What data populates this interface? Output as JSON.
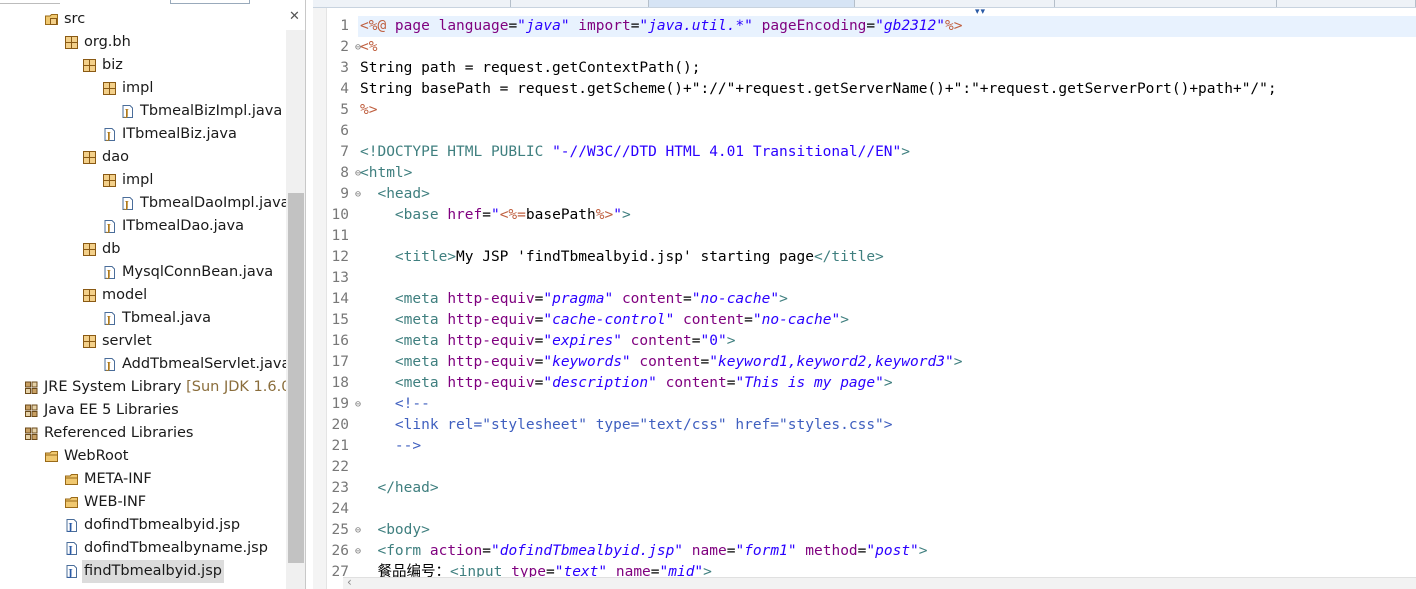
{
  "explorer": {
    "tree": [
      {
        "label": "src",
        "icon": "source-folder",
        "indent": 1
      },
      {
        "label": "org.bh",
        "icon": "package",
        "indent": 2
      },
      {
        "label": "biz",
        "icon": "package",
        "indent": 3
      },
      {
        "label": "impl",
        "icon": "package",
        "indent": 4
      },
      {
        "label": "TbmealBizImpl.java",
        "icon": "java-file",
        "indent": 5
      },
      {
        "label": "ITbmealBiz.java",
        "icon": "java-file",
        "indent": 4
      },
      {
        "label": "dao",
        "icon": "package",
        "indent": 3
      },
      {
        "label": "impl",
        "icon": "package",
        "indent": 4
      },
      {
        "label": "TbmealDaoImpl.java",
        "icon": "java-file",
        "indent": 5
      },
      {
        "label": "ITbmealDao.java",
        "icon": "java-file",
        "indent": 4
      },
      {
        "label": "db",
        "icon": "package",
        "indent": 3
      },
      {
        "label": "MysqlConnBean.java",
        "icon": "java-file",
        "indent": 4
      },
      {
        "label": "model",
        "icon": "package",
        "indent": 3
      },
      {
        "label": "Tbmeal.java",
        "icon": "java-file",
        "indent": 4
      },
      {
        "label": "servlet",
        "icon": "package",
        "indent": 3
      },
      {
        "label": "AddTbmealServlet.java",
        "icon": "java-file",
        "indent": 4
      },
      {
        "label": "JRE System Library",
        "qualifier": " [Sun JDK 1.6.0",
        "icon": "library",
        "indent": 0
      },
      {
        "label": "Java EE 5 Libraries",
        "icon": "library",
        "indent": 0
      },
      {
        "label": "Referenced Libraries",
        "icon": "library",
        "indent": 0
      },
      {
        "label": "WebRoot",
        "icon": "folder",
        "indent": 1
      },
      {
        "label": "META-INF",
        "icon": "folder",
        "indent": 2
      },
      {
        "label": "WEB-INF",
        "icon": "folder",
        "indent": 2
      },
      {
        "label": "dofindTbmealbyid.jsp",
        "icon": "jsp-file",
        "indent": 2
      },
      {
        "label": "dofindTbmealbyname.jsp",
        "icon": "jsp-file",
        "indent": 2
      },
      {
        "label": "findTbmealbyid.jsp",
        "icon": "jsp-file",
        "indent": 2,
        "selected": true
      }
    ]
  },
  "colors": {
    "keyword": "#7f0055",
    "tag": "#3f7f7f",
    "attr": "#7f007f",
    "string": "#2a00ff",
    "jsp_delim": "#bf5f3f",
    "doctype": "#3f7f7f",
    "comment": "#3f5fbf",
    "line_number": "#787878",
    "current_line": "#e8f2fe",
    "selection": "#dcdcdc"
  },
  "editor": {
    "lines": [
      {
        "n": "1",
        "current": true,
        "tokens": [
          [
            "jsp",
            "<%@"
          ],
          [
            "attr",
            " page "
          ],
          [
            "attr",
            "language"
          ],
          [
            "txt",
            "="
          ],
          [
            "str",
            "\"java\""
          ],
          [
            "txt",
            " "
          ],
          [
            "attr",
            "import"
          ],
          [
            "txt",
            "="
          ],
          [
            "str",
            "\"java.util.*\""
          ],
          [
            "txt",
            " "
          ],
          [
            "attr",
            "pageEncoding"
          ],
          [
            "txt",
            "="
          ],
          [
            "str",
            "\"gb2312\""
          ],
          [
            "jsp",
            "%>"
          ]
        ]
      },
      {
        "n": "2",
        "fold": "⊖",
        "tokens": [
          [
            "jsp",
            "<%"
          ]
        ]
      },
      {
        "n": "3",
        "tokens": [
          [
            "txt",
            "String path = request.getContextPath();"
          ]
        ]
      },
      {
        "n": "4",
        "tokens": [
          [
            "txt",
            "String basePath = request.getScheme()+\"://\"+request.getServerName()+\":\"+request.getServerPort()+path+\"/\";"
          ]
        ]
      },
      {
        "n": "5",
        "tokens": [
          [
            "jsp",
            "%>"
          ]
        ]
      },
      {
        "n": "6",
        "tokens": []
      },
      {
        "n": "7",
        "tokens": [
          [
            "tag",
            "<!DOCTYPE HTML PUBLIC "
          ],
          [
            "doc",
            "\"-//W3C//DTD HTML 4.01 Transitional//EN\""
          ],
          [
            "tag",
            ">"
          ]
        ]
      },
      {
        "n": "8",
        "fold": "⊖",
        "tokens": [
          [
            "tag",
            "<html>"
          ]
        ]
      },
      {
        "n": "9",
        "fold": "⊖",
        "tokens": [
          [
            "txt",
            "  "
          ],
          [
            "tag",
            "<head>"
          ]
        ]
      },
      {
        "n": "10",
        "tokens": [
          [
            "txt",
            "    "
          ],
          [
            "tag",
            "<base "
          ],
          [
            "attr",
            "href"
          ],
          [
            "txt",
            "="
          ],
          [
            "str",
            "\""
          ],
          [
            "jsp",
            "<%="
          ],
          [
            "txt",
            "basePath"
          ],
          [
            "jsp",
            "%>"
          ],
          [
            "str",
            "\""
          ],
          [
            "tag",
            ">"
          ]
        ]
      },
      {
        "n": "11",
        "tokens": []
      },
      {
        "n": "12",
        "tokens": [
          [
            "txt",
            "    "
          ],
          [
            "tag",
            "<title>"
          ],
          [
            "txt",
            "My JSP 'findTbmealbyid.jsp' starting page"
          ],
          [
            "tag",
            "</title>"
          ]
        ]
      },
      {
        "n": "13",
        "tokens": []
      },
      {
        "n": "14",
        "tokens": [
          [
            "txt",
            "    "
          ],
          [
            "tag",
            "<meta "
          ],
          [
            "attr",
            "http-equiv"
          ],
          [
            "txt",
            "="
          ],
          [
            "str",
            "\"pragma\""
          ],
          [
            "txt",
            " "
          ],
          [
            "attr",
            "content"
          ],
          [
            "txt",
            "="
          ],
          [
            "str",
            "\"no-cache\""
          ],
          [
            "tag",
            ">"
          ]
        ]
      },
      {
        "n": "15",
        "tokens": [
          [
            "txt",
            "    "
          ],
          [
            "tag",
            "<meta "
          ],
          [
            "attr",
            "http-equiv"
          ],
          [
            "txt",
            "="
          ],
          [
            "str",
            "\"cache-control\""
          ],
          [
            "txt",
            " "
          ],
          [
            "attr",
            "content"
          ],
          [
            "txt",
            "="
          ],
          [
            "str",
            "\"no-cache\""
          ],
          [
            "tag",
            ">"
          ]
        ]
      },
      {
        "n": "16",
        "tokens": [
          [
            "txt",
            "    "
          ],
          [
            "tag",
            "<meta "
          ],
          [
            "attr",
            "http-equiv"
          ],
          [
            "txt",
            "="
          ],
          [
            "str",
            "\"expires\""
          ],
          [
            "txt",
            " "
          ],
          [
            "attr",
            "content"
          ],
          [
            "txt",
            "="
          ],
          [
            "str",
            "\"0\""
          ],
          [
            "tag",
            ">"
          ]
        ]
      },
      {
        "n": "17",
        "tokens": [
          [
            "txt",
            "    "
          ],
          [
            "tag",
            "<meta "
          ],
          [
            "attr",
            "http-equiv"
          ],
          [
            "txt",
            "="
          ],
          [
            "str",
            "\"keywords\""
          ],
          [
            "txt",
            " "
          ],
          [
            "attr",
            "content"
          ],
          [
            "txt",
            "="
          ],
          [
            "str",
            "\"keyword1,keyword2,keyword3\""
          ],
          [
            "tag",
            ">"
          ]
        ]
      },
      {
        "n": "18",
        "tokens": [
          [
            "txt",
            "    "
          ],
          [
            "tag",
            "<meta "
          ],
          [
            "attr",
            "http-equiv"
          ],
          [
            "txt",
            "="
          ],
          [
            "str",
            "\"description\""
          ],
          [
            "txt",
            " "
          ],
          [
            "attr",
            "content"
          ],
          [
            "txt",
            "="
          ],
          [
            "str",
            "\"This is my page\""
          ],
          [
            "tag",
            ">"
          ]
        ]
      },
      {
        "n": "19",
        "fold": "⊖",
        "tokens": [
          [
            "txt",
            "    "
          ],
          [
            "com",
            "<!--"
          ]
        ]
      },
      {
        "n": "20",
        "tokens": [
          [
            "txt",
            "    "
          ],
          [
            "com",
            "<link rel=\"stylesheet\" type=\"text/css\" href=\"styles.css\">"
          ]
        ]
      },
      {
        "n": "21",
        "tokens": [
          [
            "txt",
            "    "
          ],
          [
            "com",
            "-->"
          ]
        ]
      },
      {
        "n": "22",
        "tokens": []
      },
      {
        "n": "23",
        "tokens": [
          [
            "txt",
            "  "
          ],
          [
            "tag",
            "</head>"
          ]
        ]
      },
      {
        "n": "24",
        "tokens": []
      },
      {
        "n": "25",
        "fold": "⊖",
        "tokens": [
          [
            "txt",
            "  "
          ],
          [
            "tag",
            "<body>"
          ]
        ]
      },
      {
        "n": "26",
        "fold": "⊖",
        "tokens": [
          [
            "txt",
            "  "
          ],
          [
            "tag",
            "<form "
          ],
          [
            "attr",
            "action"
          ],
          [
            "txt",
            "="
          ],
          [
            "str",
            "\"dofindTbmealbyid.jsp\""
          ],
          [
            "txt",
            " "
          ],
          [
            "attr",
            "name"
          ],
          [
            "txt",
            "="
          ],
          [
            "str",
            "\"form1\""
          ],
          [
            "txt",
            " "
          ],
          [
            "attr",
            "method"
          ],
          [
            "txt",
            "="
          ],
          [
            "str",
            "\"post\""
          ],
          [
            "tag",
            ">"
          ]
        ]
      },
      {
        "n": "27",
        "tokens": [
          [
            "txt",
            "  餐品编号："
          ],
          [
            "tag",
            "<input "
          ],
          [
            "attr",
            "type"
          ],
          [
            "txt",
            "="
          ],
          [
            "str",
            "\"text\""
          ],
          [
            "txt",
            " "
          ],
          [
            "attr",
            "name"
          ],
          [
            "txt",
            "="
          ],
          [
            "str",
            "\"mid\""
          ],
          [
            "tag",
            ">"
          ]
        ]
      }
    ]
  }
}
